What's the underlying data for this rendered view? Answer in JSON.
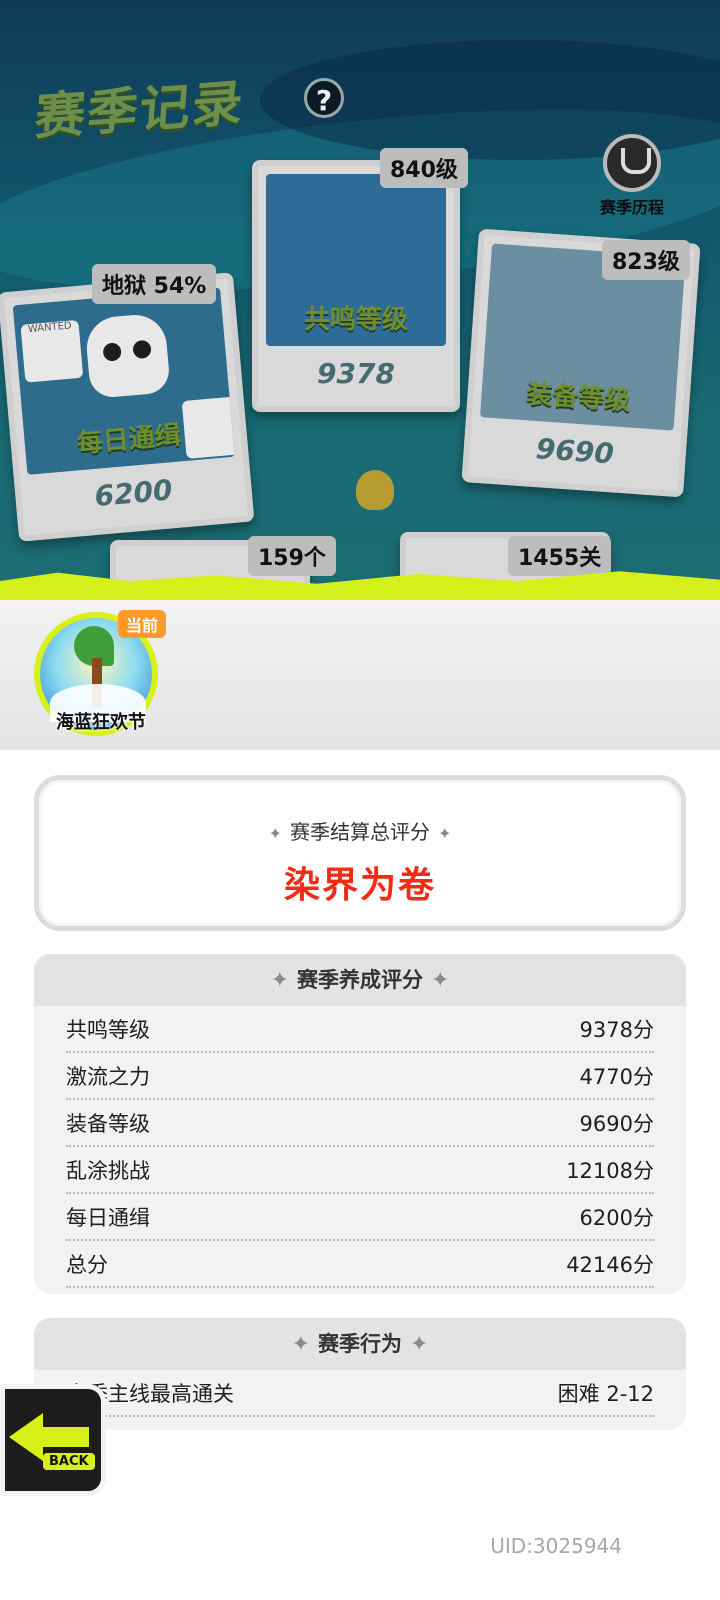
{
  "header": {
    "title": "赛季记录",
    "help_glyph": "?",
    "history_label": "赛季历程"
  },
  "cards": {
    "daily": {
      "name": "每日通缉",
      "score": "6200",
      "tag": "地狱 54%",
      "wanted_label": "WANTED"
    },
    "resonance": {
      "name": "共鸣等级",
      "score": "9378",
      "tag": "840级"
    },
    "gear": {
      "name": "装备等级",
      "score": "9690",
      "tag": "823级"
    },
    "bottom_left_tag": "159个",
    "bottom_right_tag": "1455关"
  },
  "season": {
    "name": "海蓝狂欢节",
    "current_tag": "当前"
  },
  "rating": {
    "label": "赛季结算总评分",
    "value": "染界为卷"
  },
  "nurture": {
    "title": "赛季养成评分",
    "rows": [
      {
        "label": "共鸣等级",
        "value": "9378分"
      },
      {
        "label": "激流之力",
        "value": "4770分"
      },
      {
        "label": "装备等级",
        "value": "9690分"
      },
      {
        "label": "乱涂挑战",
        "value": "12108分"
      },
      {
        "label": "每日通缉",
        "value": "6200分"
      },
      {
        "label": "总分",
        "value": "42146分"
      }
    ]
  },
  "behavior": {
    "title": "赛季行为",
    "rows": [
      {
        "label": "赛季主线最高通关",
        "value": "困难 2-12"
      }
    ]
  },
  "back_label": "BACK",
  "uid": "UID:3025944",
  "colors": {
    "accent_green": "#d4f01a",
    "rating_red": "#f52a12",
    "current_orange": "#ff9a2a"
  }
}
